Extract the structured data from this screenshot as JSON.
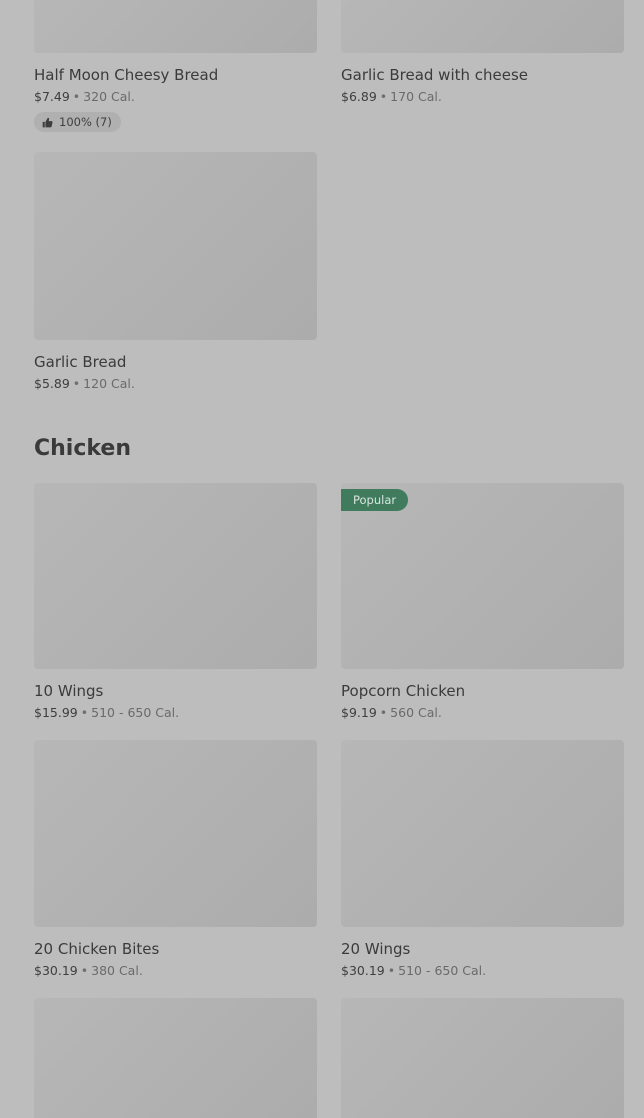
{
  "items_top": [
    {
      "name": "Half Moon Cheesy Bread",
      "price": "$7.49",
      "cal": "320 Cal.",
      "rating": "100% (7)"
    },
    {
      "name": "Garlic Bread with cheese",
      "price": "$6.89",
      "cal": "170 Cal."
    },
    {
      "name": "Garlic Bread",
      "price": "$5.89",
      "cal": "120 Cal."
    }
  ],
  "chicken": {
    "title": "Chicken",
    "items": [
      {
        "name": "10 Wings",
        "price": "$15.99",
        "cal": "510 - 650 Cal."
      },
      {
        "name": "Popcorn Chicken",
        "price": "$9.19",
        "cal": "560 Cal.",
        "badge": "Popular"
      },
      {
        "name": "20 Chicken Bites",
        "price": "$30.19",
        "cal": "380 Cal."
      },
      {
        "name": "20 Wings",
        "price": "$30.19",
        "cal": "510 - 650 Cal."
      }
    ]
  },
  "separator": "•",
  "icons": {
    "rating": "thumbs-up-icon"
  }
}
